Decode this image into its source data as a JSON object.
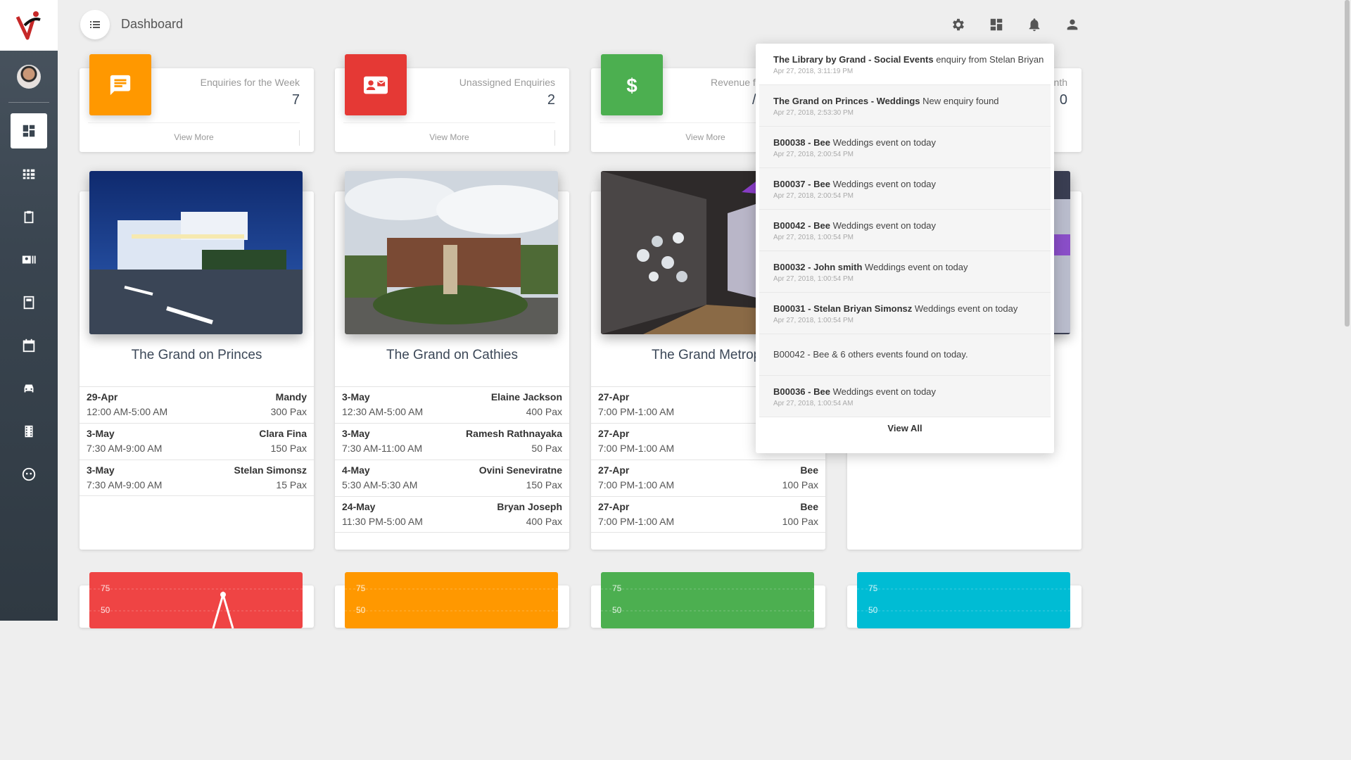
{
  "header": {
    "title": "Dashboard"
  },
  "stats": [
    {
      "label": "Enquiries for the Week",
      "value": "7",
      "footer": "View More",
      "color": "#ff9800",
      "icon": "chat-icon"
    },
    {
      "label": "Unassigned Enquiries",
      "value": "2",
      "footer": "View More",
      "color": "#f44336",
      "icon": "contact-mail-icon"
    },
    {
      "label": "Revenue f",
      "value": "/",
      "footer": "View More",
      "color": "#4caf50",
      "icon": "dollar-icon"
    },
    {
      "label": "nth",
      "value": "0",
      "footer": "",
      "color": "#00bcd4",
      "icon": ""
    }
  ],
  "venues": [
    {
      "name": "The Grand on Princes",
      "bookings": [
        {
          "date": "29-Apr",
          "time": "12:00 AM-5:00 AM",
          "name": "Mandy",
          "pax": "300 Pax"
        },
        {
          "date": "3-May",
          "time": "7:30 AM-9:00 AM",
          "name": "Clara Fina",
          "pax": "150 Pax"
        },
        {
          "date": "3-May",
          "time": "7:30 AM-9:00 AM",
          "name": "Stelan Simonsz",
          "pax": "15 Pax"
        }
      ]
    },
    {
      "name": "The Grand on Cathies",
      "bookings": [
        {
          "date": "3-May",
          "time": "12:30 AM-5:00 AM",
          "name": "Elaine Jackson",
          "pax": "400 Pax"
        },
        {
          "date": "3-May",
          "time": "7:30 AM-11:00 AM",
          "name": "Ramesh Rathnayaka",
          "pax": "50 Pax"
        },
        {
          "date": "4-May",
          "time": "5:30 AM-5:30 AM",
          "name": "Ovini Seneviratne",
          "pax": "150 Pax"
        },
        {
          "date": "24-May",
          "time": "11:30 PM-5:00 AM",
          "name": "Bryan Joseph",
          "pax": "400 Pax"
        }
      ]
    },
    {
      "name": "The Grand Metrop",
      "bookings": [
        {
          "date": "27-Apr",
          "time": "7:00 PM-1:00 AM",
          "name": "",
          "pax": ""
        },
        {
          "date": "27-Apr",
          "time": "7:00 PM-1:00 AM",
          "name": "",
          "pax": ""
        },
        {
          "date": "27-Apr",
          "time": "7:00 PM-1:00 AM",
          "name": "Bee",
          "pax": "100 Pax"
        },
        {
          "date": "27-Apr",
          "time": "7:00 PM-1:00 AM",
          "name": "Bee",
          "pax": "100 Pax"
        }
      ]
    }
  ],
  "notifications": {
    "items": [
      {
        "bold": "The Library by Grand - Social Events",
        "text": " enquiry from Stelan Briyan",
        "time": "Apr 27, 2018, 3:11:19 PM"
      },
      {
        "bold": "The Grand on Princes - Weddings",
        "text": " New enquiry found",
        "time": "Apr 27, 2018, 2:53:30 PM"
      },
      {
        "bold": "B00038 - Bee",
        "text": " Weddings event on today",
        "time": "Apr 27, 2018, 2:00:54 PM"
      },
      {
        "bold": "B00037 - Bee",
        "text": " Weddings event on today",
        "time": "Apr 27, 2018, 2:00:54 PM"
      },
      {
        "bold": "B00042 - Bee",
        "text": " Weddings event on today",
        "time": "Apr 27, 2018, 1:00:54 PM"
      },
      {
        "bold": "B00032 - John smith",
        "text": " Weddings event on today",
        "time": "Apr 27, 2018, 1:00:54 PM"
      },
      {
        "bold": "B00031 - Stelan Briyan Simonsz",
        "text": " Weddings event on today",
        "time": "Apr 27, 2018, 1:00:54 PM"
      },
      {
        "bold": "",
        "text": "B00042 - Bee & 6 others events found on today.",
        "time": ""
      },
      {
        "bold": "B00036 - Bee",
        "text": " Weddings event on today",
        "time": "Apr 27, 2018, 1:00:54 AM"
      }
    ],
    "view_all": "View All"
  },
  "charts": [
    {
      "color": "#f44336",
      "ticks": [
        "75",
        "50"
      ]
    },
    {
      "color": "#ff9800",
      "ticks": [
        "75",
        "50"
      ]
    },
    {
      "color": "#4caf50",
      "ticks": [
        "75",
        "50"
      ]
    },
    {
      "color": "#00bcd4",
      "ticks": [
        "75",
        "50"
      ]
    }
  ],
  "sidebar": {
    "items": [
      "dashboard-icon",
      "grid-icon",
      "clipboard-icon",
      "contacts-icon",
      "calculator-icon",
      "calendar-icon",
      "car-icon",
      "film-icon",
      "face-icon"
    ],
    "active": 0
  }
}
